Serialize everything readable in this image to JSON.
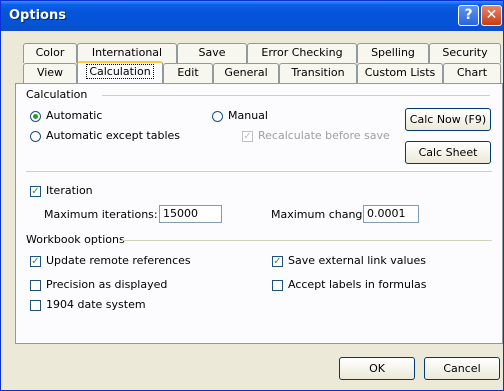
{
  "window": {
    "title": "Options",
    "help_glyph": "?",
    "close_glyph": "✕"
  },
  "tabs_row1": [
    {
      "label": "Color"
    },
    {
      "label": "International"
    },
    {
      "label": "Save"
    },
    {
      "label": "Error Checking"
    },
    {
      "label": "Spelling"
    },
    {
      "label": "Security"
    }
  ],
  "tabs_row2": [
    {
      "label": "View"
    },
    {
      "label": "Calculation"
    },
    {
      "label": "Edit"
    },
    {
      "label": "General"
    },
    {
      "label": "Transition"
    },
    {
      "label": "Custom Lists"
    },
    {
      "label": "Chart"
    }
  ],
  "active_tab": "Calculation",
  "calculation": {
    "group_label": "Calculation",
    "automatic": {
      "label": "Automatic",
      "selected": true
    },
    "automatic_except_tables": {
      "label": "Automatic except tables",
      "selected": false
    },
    "manual": {
      "label": "Manual",
      "selected": false
    },
    "recalculate_before_save": {
      "label": "Recalculate before save",
      "checked": true,
      "enabled": false
    },
    "calc_now_label": "Calc Now (F9)",
    "calc_sheet_label": "Calc Sheet"
  },
  "iteration": {
    "label": "Iteration",
    "checked": true,
    "max_iterations_label": "Maximum iterations:",
    "max_iterations_value": "15000",
    "max_change_label": "Maximum change:",
    "max_change_value": "0.0001"
  },
  "workbook_options": {
    "group_label": "Workbook options",
    "update_remote_references": {
      "label": "Update remote references",
      "checked": true
    },
    "save_external_link_values": {
      "label": "Save external link values",
      "checked": true
    },
    "precision_as_displayed": {
      "label": "Precision as displayed",
      "checked": false
    },
    "accept_labels_in_formulas": {
      "label": "Accept labels in formulas",
      "checked": false
    },
    "date_system_1904": {
      "label": "1904 date system",
      "checked": false
    }
  },
  "footer": {
    "ok_label": "OK",
    "cancel_label": "Cancel"
  },
  "check_glyph": "✓"
}
